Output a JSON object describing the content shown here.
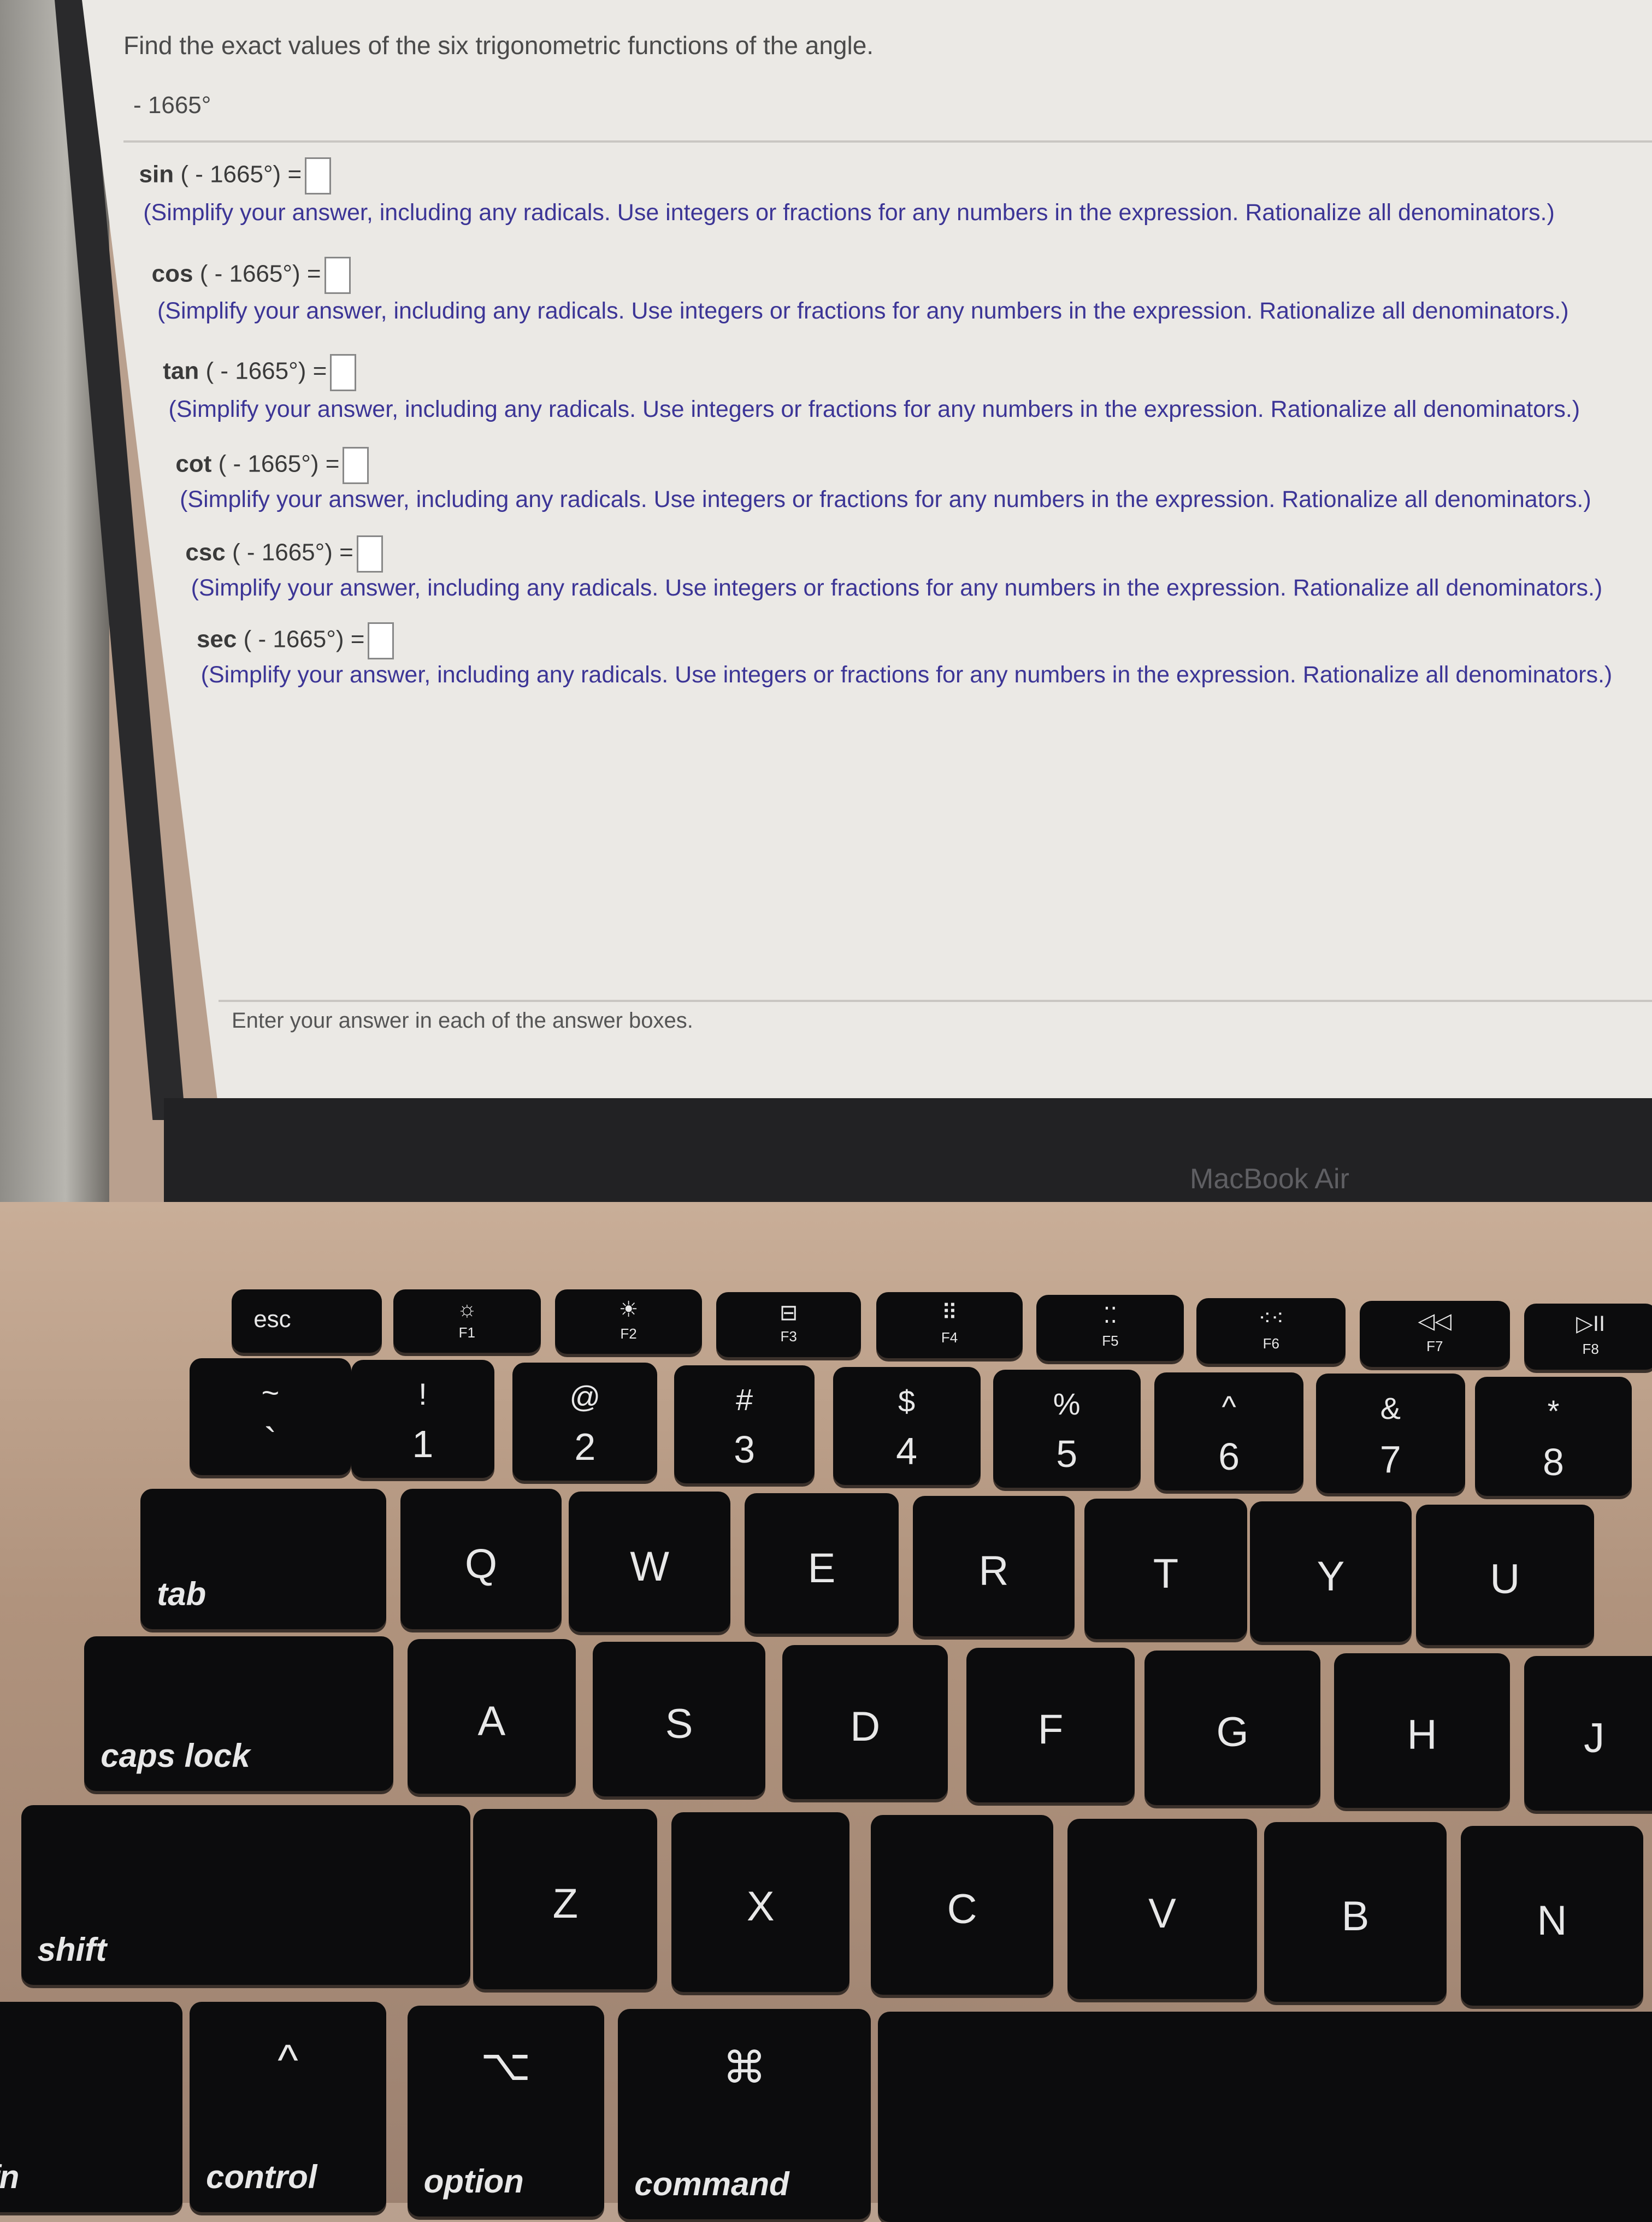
{
  "question": {
    "title": "Find the exact values of the six trigonometric functions of the angle.",
    "angle": "- 1665°",
    "hint": "(Simplify your answer, including any radicals. Use integers or fractions for any numbers in the expression. Rationalize all denominators.)",
    "items": [
      {
        "fn": "sin",
        "arg": "( - 1665°) =",
        "value": ""
      },
      {
        "fn": "cos",
        "arg": "( - 1665°) =",
        "value": ""
      },
      {
        "fn": "tan",
        "arg": "( - 1665°) =",
        "value": ""
      },
      {
        "fn": "cot",
        "arg": "( - 1665°) =",
        "value": ""
      },
      {
        "fn": "csc",
        "arg": "( - 1665°) =",
        "value": ""
      },
      {
        "fn": "sec",
        "arg": "( - 1665°) =",
        "value": ""
      }
    ],
    "footer": "Enter your answer in each of the answer boxes."
  },
  "laptop": {
    "brand": "MacBook Air"
  },
  "keyboard": {
    "keys": [
      {
        "main": "esc",
        "type": "mod"
      },
      {
        "icon": "☼",
        "fk": "F1",
        "type": "f",
        "name": "brightness-down"
      },
      {
        "icon": "☀",
        "fk": "F2",
        "type": "f",
        "name": "brightness-up"
      },
      {
        "icon": "⊟",
        "fk": "F3",
        "type": "f",
        "name": "mission-control"
      },
      {
        "icon": "⠿",
        "fk": "F4",
        "type": "f",
        "name": "launchpad"
      },
      {
        "icon": "⁚⁚",
        "fk": "F5",
        "type": "f",
        "name": "keyboard-light-down"
      },
      {
        "icon": "⁖⁖",
        "fk": "F6",
        "type": "f",
        "name": "keyboard-light-up"
      },
      {
        "icon": "◁◁",
        "fk": "F7",
        "type": "f",
        "name": "rewind"
      },
      {
        "icon": "▷II",
        "fk": "F8",
        "type": "f",
        "name": "play-pause"
      },
      {
        "shift": "~",
        "num": "`",
        "type": "n"
      },
      {
        "shift": "!",
        "num": "1",
        "type": "n"
      },
      {
        "shift": "@",
        "num": "2",
        "type": "n"
      },
      {
        "shift": "#",
        "num": "3",
        "type": "n"
      },
      {
        "shift": "$",
        "num": "4",
        "type": "n"
      },
      {
        "shift": "%",
        "num": "5",
        "type": "n"
      },
      {
        "shift": "^",
        "num": "6",
        "type": "n"
      },
      {
        "shift": "&",
        "num": "7",
        "type": "n"
      },
      {
        "shift": "*",
        "num": "8",
        "type": "n"
      },
      {
        "main": "tab",
        "type": "mod"
      },
      {
        "main": "Q"
      },
      {
        "main": "W"
      },
      {
        "main": "E"
      },
      {
        "main": "R"
      },
      {
        "main": "T"
      },
      {
        "main": "Y"
      },
      {
        "main": "U"
      },
      {
        "main": "caps lock",
        "type": "mod"
      },
      {
        "main": "A"
      },
      {
        "main": "S"
      },
      {
        "main": "D"
      },
      {
        "main": "F"
      },
      {
        "main": "G"
      },
      {
        "main": "H"
      },
      {
        "main": "J"
      },
      {
        "main": "shift",
        "type": "mod"
      },
      {
        "main": "Z"
      },
      {
        "main": "X"
      },
      {
        "main": "C"
      },
      {
        "main": "V"
      },
      {
        "main": "B"
      },
      {
        "main": "N"
      },
      {
        "main": "fn",
        "type": "mod"
      },
      {
        "main": "control",
        "sym": "^",
        "type": "mod"
      },
      {
        "main": "option",
        "sym": "⌥",
        "type": "mod"
      },
      {
        "main": "command",
        "sym": "⌘",
        "type": "mod"
      },
      {
        "main": "",
        "type": "space"
      }
    ]
  }
}
